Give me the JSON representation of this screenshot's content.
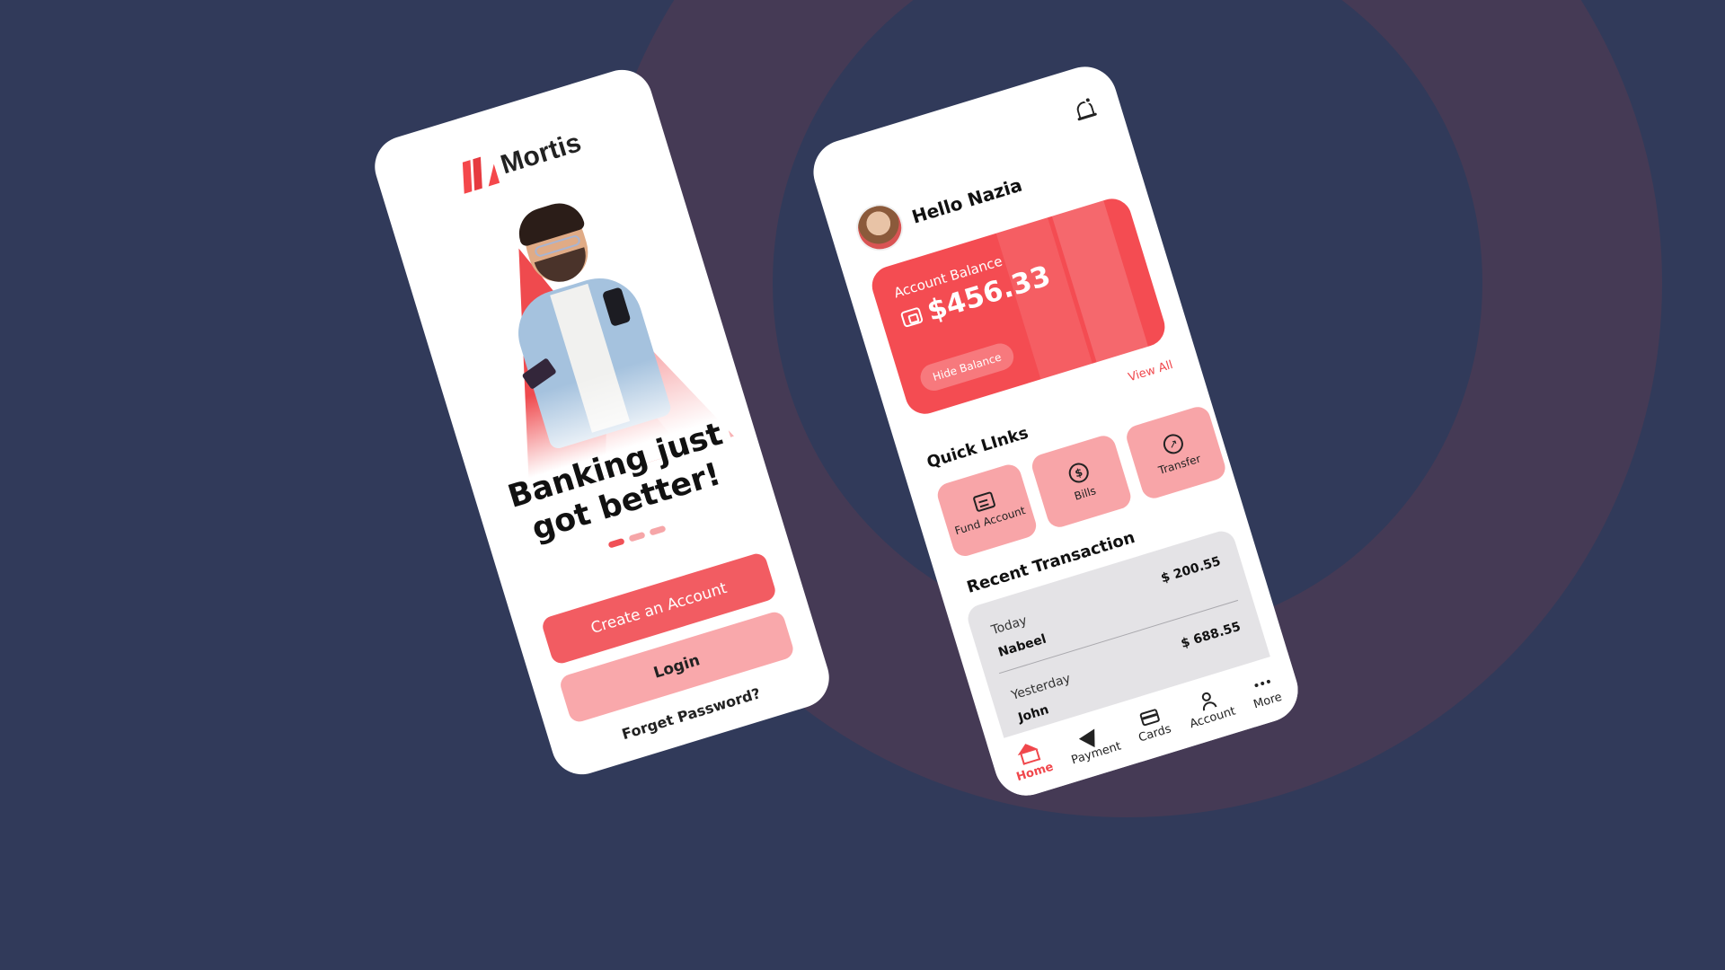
{
  "colors": {
    "background": "#313a5a",
    "ring": "#453a55",
    "brand_red": "#f4474b",
    "brand_pink": "#f8a5a8"
  },
  "onboarding": {
    "logo_text": "Mortis",
    "headline_line1": "Banking just",
    "headline_line2": "got better!",
    "carousel_pages": 3,
    "carousel_active": 1,
    "create_account_label": "Create an Account",
    "login_label": "Login",
    "forgot_password_label": "Forget Password?"
  },
  "home": {
    "greeting": "Hello Nazia",
    "icons": {
      "notification": "bell-icon",
      "wallet": "wallet-icon"
    },
    "balance": {
      "label": "Account Balance",
      "amount": "$456.33",
      "hide_label": "Hide Balance"
    },
    "view_all_label": "View All",
    "quick_links_title": "Quick LInks",
    "quick_links": [
      {
        "label": "Fund Account",
        "icon": "fund-account-icon"
      },
      {
        "label": "Bills",
        "icon": "dollar-circle-icon"
      },
      {
        "label": "Transfer",
        "icon": "transfer-icon"
      }
    ],
    "recent_title": "Recent Transaction",
    "transactions": [
      {
        "when": "Today",
        "name": "Nabeel",
        "amount": "$ 200.55"
      },
      {
        "when": "Yesterday",
        "name": "John",
        "amount": "$ 688.55"
      }
    ],
    "nav": [
      {
        "label": "Home",
        "icon": "home-icon",
        "active": true
      },
      {
        "label": "Payment",
        "icon": "send-icon",
        "active": false
      },
      {
        "label": "Cards",
        "icon": "card-icon",
        "active": false
      },
      {
        "label": "Account",
        "icon": "user-icon",
        "active": false
      },
      {
        "label": "More",
        "icon": "more-icon",
        "active": false
      }
    ]
  }
}
